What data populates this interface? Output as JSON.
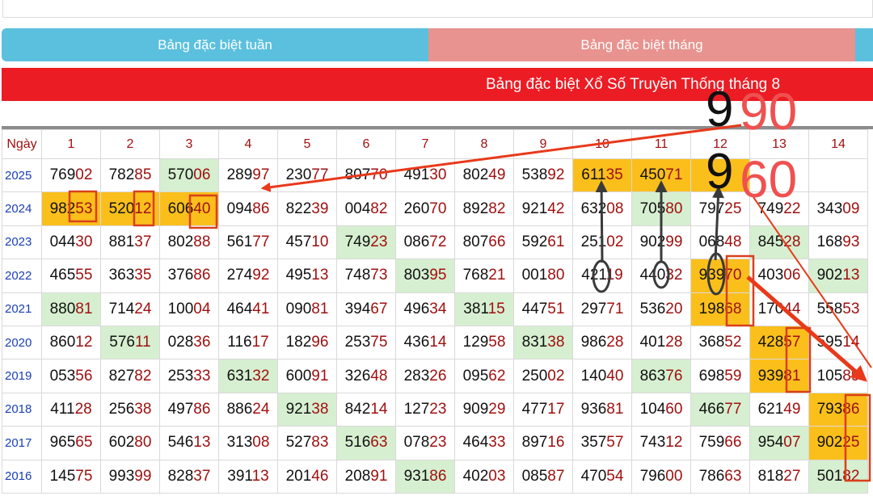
{
  "tabs": {
    "week_label": "Bảng đặc biệt tuần",
    "month_label": "Bảng đặc biệt tháng"
  },
  "banner": {
    "title": "Bảng đặc biệt Xổ Số Truyền Thống tháng 8"
  },
  "annotations": {
    "top_left_digit": "9",
    "top_right_number": "90",
    "bottom_left_digit": "9",
    "bottom_right_number": "60"
  },
  "colors": {
    "tab_week": "#5bc0de",
    "tab_month": "#e8938f",
    "banner": "#ec1c24",
    "cell_yellow": "#fbbf1c",
    "cell_green": "#d6efd0",
    "tail_digits": "#a01010",
    "year_text": "#1a3fb3",
    "annotation_red": "#f05050",
    "arrow_red": "#e8391a"
  },
  "table": {
    "corner_label": "Ngày",
    "columns": [
      "1",
      "2",
      "3",
      "4",
      "5",
      "6",
      "7",
      "8",
      "9",
      "10",
      "11",
      "12",
      "13",
      "14"
    ],
    "rows": [
      {
        "year": "2025",
        "cells": [
          {
            "v": "76902",
            "h": ""
          },
          {
            "v": "78285",
            "h": ""
          },
          {
            "v": "57006",
            "h": "green"
          },
          {
            "v": "28997",
            "h": ""
          },
          {
            "v": "23077",
            "h": ""
          },
          {
            "v": "80770",
            "h": ""
          },
          {
            "v": "49130",
            "h": ""
          },
          {
            "v": "80249",
            "h": ""
          },
          {
            "v": "53892",
            "h": ""
          },
          {
            "v": "61135",
            "h": "yellow"
          },
          {
            "v": "45071",
            "h": "yellow"
          },
          {
            "v": "",
            "h": "yellow"
          },
          {
            "v": "",
            "h": ""
          },
          {
            "v": "",
            "h": ""
          }
        ]
      },
      {
        "year": "2024",
        "cells": [
          {
            "v": "98253",
            "h": "yellow"
          },
          {
            "v": "52012",
            "h": "yellow"
          },
          {
            "v": "60640",
            "h": "yellow"
          },
          {
            "v": "09486",
            "h": ""
          },
          {
            "v": "82239",
            "h": ""
          },
          {
            "v": "00482",
            "h": ""
          },
          {
            "v": "26070",
            "h": ""
          },
          {
            "v": "89282",
            "h": ""
          },
          {
            "v": "92142",
            "h": ""
          },
          {
            "v": "63208",
            "h": ""
          },
          {
            "v": "70580",
            "h": "green"
          },
          {
            "v": "79725",
            "h": ""
          },
          {
            "v": "74922",
            "h": ""
          },
          {
            "v": "34309",
            "h": ""
          }
        ]
      },
      {
        "year": "2023",
        "cells": [
          {
            "v": "04430",
            "h": ""
          },
          {
            "v": "88137",
            "h": ""
          },
          {
            "v": "80288",
            "h": ""
          },
          {
            "v": "56177",
            "h": ""
          },
          {
            "v": "45710",
            "h": ""
          },
          {
            "v": "74923",
            "h": "green"
          },
          {
            "v": "08672",
            "h": ""
          },
          {
            "v": "80766",
            "h": ""
          },
          {
            "v": "59261",
            "h": ""
          },
          {
            "v": "25102",
            "h": ""
          },
          {
            "v": "90299",
            "h": ""
          },
          {
            "v": "06848",
            "h": ""
          },
          {
            "v": "84528",
            "h": "green"
          },
          {
            "v": "16893",
            "h": ""
          }
        ]
      },
      {
        "year": "2022",
        "cells": [
          {
            "v": "46555",
            "h": ""
          },
          {
            "v": "36335",
            "h": ""
          },
          {
            "v": "37686",
            "h": ""
          },
          {
            "v": "27492",
            "h": ""
          },
          {
            "v": "49513",
            "h": ""
          },
          {
            "v": "74873",
            "h": ""
          },
          {
            "v": "80395",
            "h": "green"
          },
          {
            "v": "76821",
            "h": ""
          },
          {
            "v": "00180",
            "h": ""
          },
          {
            "v": "42119",
            "h": ""
          },
          {
            "v": "44032",
            "h": ""
          },
          {
            "v": "93970",
            "h": "yellow"
          },
          {
            "v": "40306",
            "h": ""
          },
          {
            "v": "90213",
            "h": "green"
          }
        ]
      },
      {
        "year": "2021",
        "cells": [
          {
            "v": "88081",
            "h": "green"
          },
          {
            "v": "71424",
            "h": ""
          },
          {
            "v": "10004",
            "h": ""
          },
          {
            "v": "46441",
            "h": ""
          },
          {
            "v": "09081",
            "h": ""
          },
          {
            "v": "39467",
            "h": ""
          },
          {
            "v": "49634",
            "h": ""
          },
          {
            "v": "38115",
            "h": "green"
          },
          {
            "v": "44751",
            "h": ""
          },
          {
            "v": "29771",
            "h": ""
          },
          {
            "v": "53620",
            "h": ""
          },
          {
            "v": "19868",
            "h": "yellow"
          },
          {
            "v": "17044",
            "h": ""
          },
          {
            "v": "55853",
            "h": ""
          }
        ]
      },
      {
        "year": "2020",
        "cells": [
          {
            "v": "86012",
            "h": ""
          },
          {
            "v": "57611",
            "h": "green"
          },
          {
            "v": "02836",
            "h": ""
          },
          {
            "v": "11617",
            "h": ""
          },
          {
            "v": "18296",
            "h": ""
          },
          {
            "v": "25375",
            "h": ""
          },
          {
            "v": "43614",
            "h": ""
          },
          {
            "v": "12958",
            "h": ""
          },
          {
            "v": "83138",
            "h": "green"
          },
          {
            "v": "98628",
            "h": ""
          },
          {
            "v": "40128",
            "h": ""
          },
          {
            "v": "36852",
            "h": ""
          },
          {
            "v": "42857",
            "h": "yellow"
          },
          {
            "v": "59514",
            "h": ""
          }
        ]
      },
      {
        "year": "2019",
        "cells": [
          {
            "v": "05356",
            "h": ""
          },
          {
            "v": "82782",
            "h": ""
          },
          {
            "v": "25333",
            "h": ""
          },
          {
            "v": "63132",
            "h": "green"
          },
          {
            "v": "60091",
            "h": ""
          },
          {
            "v": "32648",
            "h": ""
          },
          {
            "v": "28326",
            "h": ""
          },
          {
            "v": "09562",
            "h": ""
          },
          {
            "v": "25002",
            "h": ""
          },
          {
            "v": "14040",
            "h": ""
          },
          {
            "v": "86376",
            "h": "green"
          },
          {
            "v": "69859",
            "h": ""
          },
          {
            "v": "93981",
            "h": "yellow"
          },
          {
            "v": "10589",
            "h": ""
          }
        ]
      },
      {
        "year": "2018",
        "cells": [
          {
            "v": "41128",
            "h": ""
          },
          {
            "v": "25638",
            "h": ""
          },
          {
            "v": "49786",
            "h": ""
          },
          {
            "v": "88624",
            "h": ""
          },
          {
            "v": "92138",
            "h": "green"
          },
          {
            "v": "84214",
            "h": ""
          },
          {
            "v": "12723",
            "h": ""
          },
          {
            "v": "90929",
            "h": ""
          },
          {
            "v": "47717",
            "h": ""
          },
          {
            "v": "93681",
            "h": ""
          },
          {
            "v": "10460",
            "h": ""
          },
          {
            "v": "46677",
            "h": "green"
          },
          {
            "v": "62149",
            "h": ""
          },
          {
            "v": "79386",
            "h": "yellow"
          }
        ]
      },
      {
        "year": "2017",
        "cells": [
          {
            "v": "96565",
            "h": ""
          },
          {
            "v": "60280",
            "h": ""
          },
          {
            "v": "54613",
            "h": ""
          },
          {
            "v": "31308",
            "h": ""
          },
          {
            "v": "52783",
            "h": ""
          },
          {
            "v": "51663",
            "h": "green"
          },
          {
            "v": "07823",
            "h": ""
          },
          {
            "v": "46433",
            "h": ""
          },
          {
            "v": "89716",
            "h": ""
          },
          {
            "v": "35757",
            "h": ""
          },
          {
            "v": "74312",
            "h": ""
          },
          {
            "v": "75966",
            "h": ""
          },
          {
            "v": "95407",
            "h": "green"
          },
          {
            "v": "90225",
            "h": "yellow"
          }
        ]
      },
      {
        "year": "2016",
        "cells": [
          {
            "v": "14575",
            "h": ""
          },
          {
            "v": "99399",
            "h": ""
          },
          {
            "v": "82837",
            "h": ""
          },
          {
            "v": "39113",
            "h": ""
          },
          {
            "v": "20146",
            "h": ""
          },
          {
            "v": "20891",
            "h": ""
          },
          {
            "v": "93186",
            "h": "green"
          },
          {
            "v": "40203",
            "h": ""
          },
          {
            "v": "08587",
            "h": ""
          },
          {
            "v": "47054",
            "h": ""
          },
          {
            "v": "79600",
            "h": ""
          },
          {
            "v": "78663",
            "h": ""
          },
          {
            "v": "81827",
            "h": ""
          },
          {
            "v": "50182",
            "h": "green"
          }
        ]
      }
    ]
  }
}
